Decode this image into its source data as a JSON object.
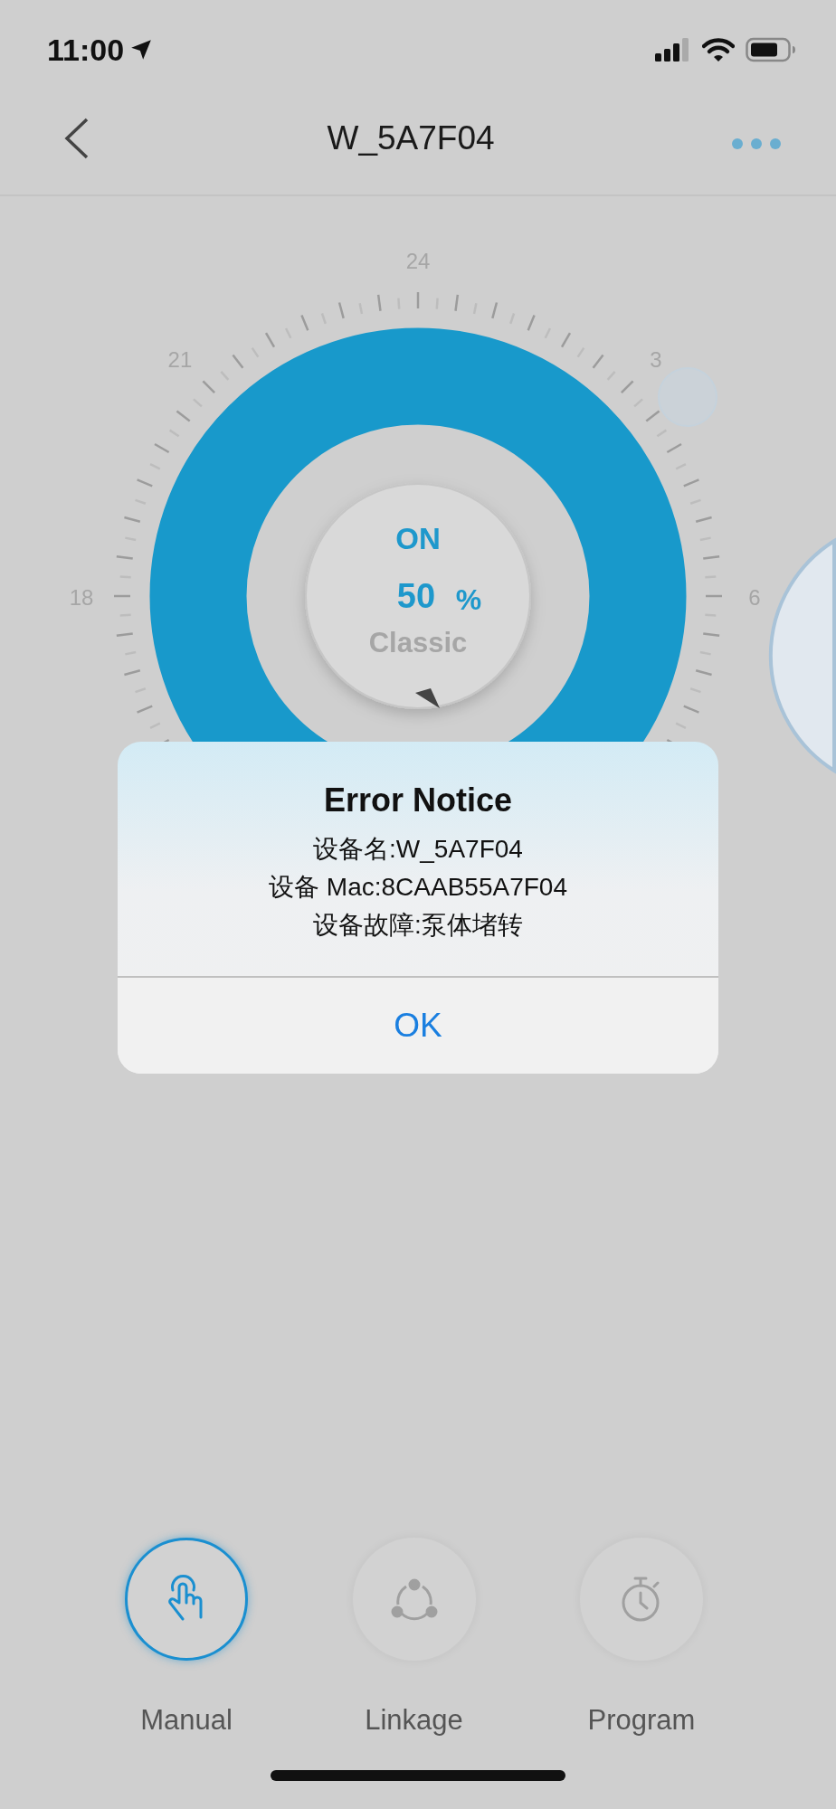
{
  "status_bar": {
    "time": "11:00"
  },
  "nav": {
    "title": "W_5A7F04"
  },
  "dial": {
    "hour_labels": [
      "24",
      "21",
      "3",
      "18",
      "6"
    ],
    "state": "ON",
    "value": "50",
    "unit": "%",
    "mode": "Classic"
  },
  "alert": {
    "title": "Error Notice",
    "lines": [
      "设备名:W_5A7F04",
      "设备 Mac:8CAAB55A7F04",
      "设备故障:泵体堵转"
    ],
    "button": "OK"
  },
  "tabs": [
    {
      "label": "Manual",
      "kind": "touch",
      "selected": true
    },
    {
      "label": "Linkage",
      "kind": "network",
      "selected": false
    },
    {
      "label": "Program",
      "kind": "timer",
      "selected": false
    }
  ]
}
